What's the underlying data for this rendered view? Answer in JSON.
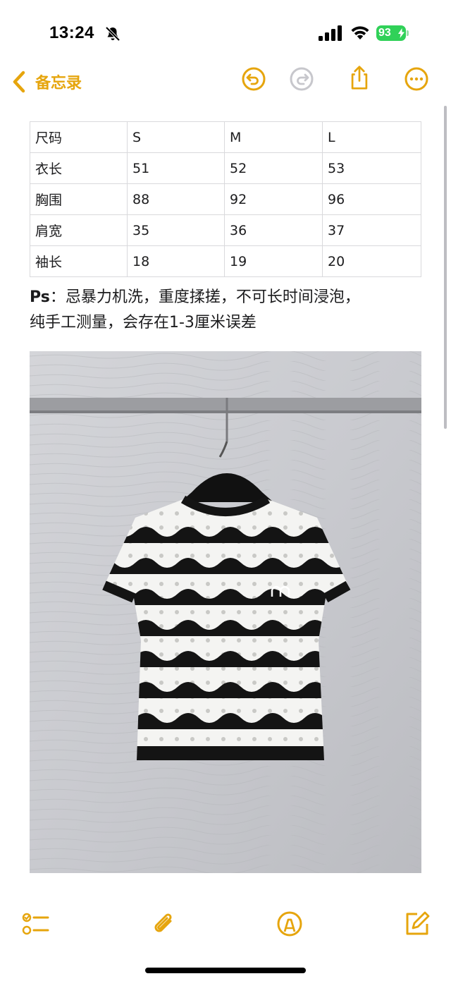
{
  "status_bar": {
    "time": "13:24",
    "battery_level": "93",
    "battery_color": "#30d158"
  },
  "nav": {
    "back_label": "备忘录",
    "accent_color": "#e6a50d",
    "icons": [
      "chevron-left-icon",
      "undo-icon",
      "redo-icon",
      "share-icon",
      "more-icon"
    ]
  },
  "size_table": {
    "header": [
      "尺码",
      "S",
      "M",
      "L"
    ],
    "rows": [
      [
        "衣长",
        "51",
        "52",
        "53"
      ],
      [
        "胸围",
        "88",
        "92",
        "96"
      ],
      [
        "肩宽",
        "35",
        "36",
        "37"
      ],
      [
        "袖长",
        "18",
        "19",
        "20"
      ]
    ]
  },
  "note": {
    "ps_label": "Ps",
    "line1": "：忌暴力机洗，重度揉搓，不可长时间浸泡，",
    "line2": "纯手工测量，会存在1-3厘米误差"
  },
  "toolbar": {
    "icons": [
      "checklist-icon",
      "paperclip-icon",
      "markup-pen-icon",
      "compose-icon"
    ]
  }
}
